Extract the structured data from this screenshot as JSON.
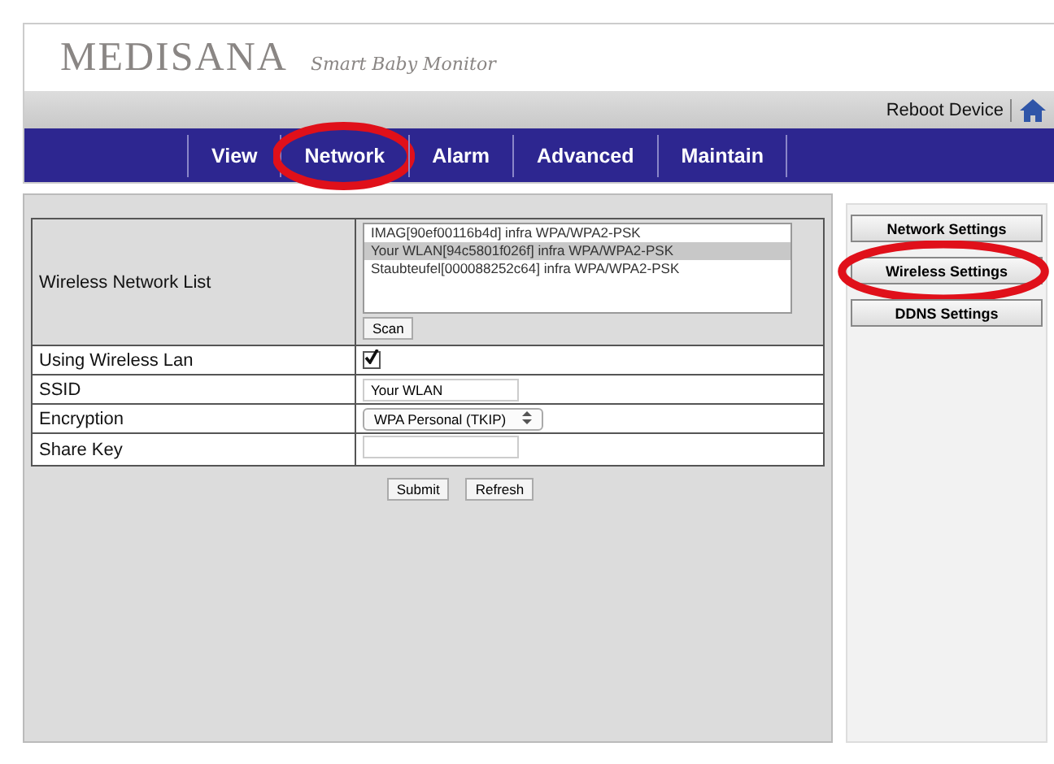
{
  "header": {
    "brand": "MEDISANA",
    "tagline": "Smart Baby Monitor",
    "reboot": "Reboot Device"
  },
  "nav": [
    {
      "label": "View",
      "circled": false
    },
    {
      "label": "Network",
      "circled": true
    },
    {
      "label": "Alarm",
      "circled": false
    },
    {
      "label": "Advanced",
      "circled": false
    },
    {
      "label": "Maintain",
      "circled": false
    }
  ],
  "form": {
    "network_list_label": "Wireless Network List",
    "networks": [
      {
        "label": "IMAG[90ef00116b4d] infra WPA/WPA2-PSK",
        "selected": false
      },
      {
        "label": "Your WLAN[94c5801f026f] infra WPA/WPA2-PSK",
        "selected": true
      },
      {
        "label": "Staubteufel[000088252c64] infra WPA/WPA2-PSK",
        "selected": false
      }
    ],
    "scan": "Scan",
    "rows": [
      {
        "kind": "checkbox",
        "label": "Using Wireless Lan",
        "checked": true
      },
      {
        "kind": "text",
        "label": "SSID",
        "value": "Your WLAN"
      },
      {
        "kind": "select",
        "label": "Encryption",
        "value": "WPA Personal (TKIP)"
      },
      {
        "kind": "text",
        "label": "Share Key",
        "value": ""
      }
    ],
    "buttons": [
      "Submit",
      "Refresh"
    ]
  },
  "side": [
    {
      "label": "Network Settings",
      "circled": false
    },
    {
      "label": "Wireless Settings",
      "circled": true
    },
    {
      "label": "DDNS Settings",
      "circled": false
    }
  ]
}
